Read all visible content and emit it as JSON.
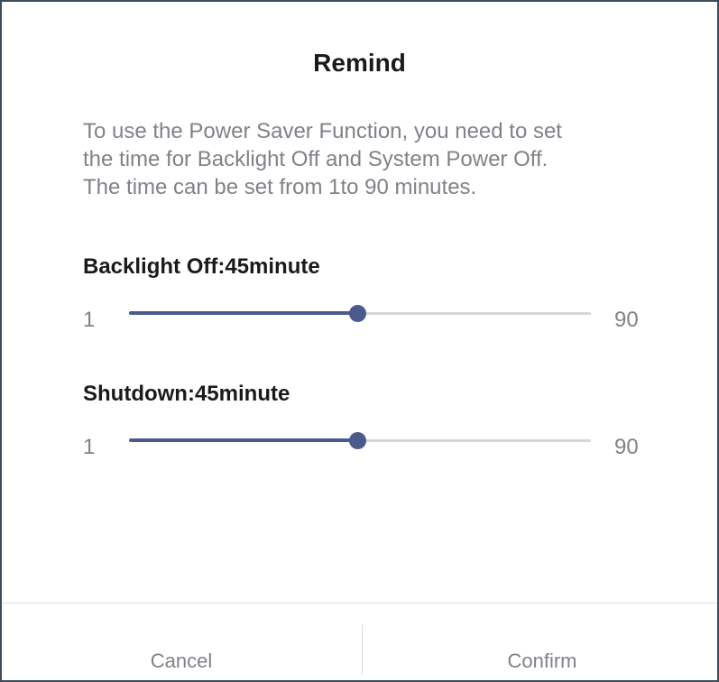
{
  "dialog": {
    "title": "Remind",
    "message_lines": [
      "To use the Power Saver Function, you need to set",
      "the time for Backlight Off and System Power Off.",
      "The time can be set from 1to 90 minutes."
    ]
  },
  "settings": [
    {
      "label": "Backlight Off:45minute",
      "min_label": "1",
      "max_label": "90",
      "min": 1,
      "max": 90,
      "value": 45
    },
    {
      "label": "Shutdown:45minute",
      "min_label": "1",
      "max_label": "90",
      "min": 1,
      "max": 90,
      "value": 45
    }
  ],
  "footer": {
    "cancel_label": "Cancel",
    "confirm_label": "Confirm"
  },
  "colors": {
    "accent": "#4a5a8c",
    "track": "#d6d6d8",
    "muted_text": "#808288",
    "title_text": "#1a1a1a",
    "border": "#3d4a58"
  }
}
